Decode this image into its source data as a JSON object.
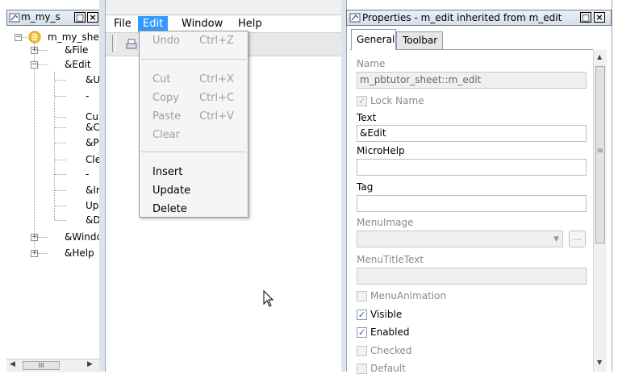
{
  "tree_panel": {
    "title": "m_my_s",
    "root_label": "m_my_shee",
    "items": [
      {
        "label": "&File",
        "depth": 1,
        "expander": "+"
      },
      {
        "label": "&Edit",
        "depth": 1,
        "expander": "-"
      },
      {
        "label": "&U",
        "depth": 2
      },
      {
        "label": "-",
        "depth": 2
      },
      {
        "label": "Cu",
        "depth": 2
      },
      {
        "label": "&C",
        "depth": 2
      },
      {
        "label": "&P",
        "depth": 2
      },
      {
        "label": "Cle",
        "depth": 2
      },
      {
        "label": "-",
        "depth": 2
      },
      {
        "label": "&Ir",
        "depth": 2
      },
      {
        "label": "Up",
        "depth": 2
      },
      {
        "label": "&D",
        "depth": 2
      },
      {
        "label": "&Windc",
        "depth": 1,
        "expander": "+"
      },
      {
        "label": "&Help",
        "depth": 1,
        "expander": "+"
      }
    ],
    "scroll_grip": "III"
  },
  "menubar": {
    "items": [
      "File",
      "Edit",
      "Window",
      "Help"
    ],
    "active": "Edit"
  },
  "edit_menu": {
    "items": [
      {
        "label": "Undo",
        "shortcut": "Ctrl+Z",
        "enabled": false
      },
      {
        "label": "Cut",
        "shortcut": "Ctrl+X",
        "enabled": false
      },
      {
        "label": "Copy",
        "shortcut": "Ctrl+C",
        "enabled": false
      },
      {
        "label": "Paste",
        "shortcut": "Ctrl+V",
        "enabled": false
      },
      {
        "label": "Clear",
        "shortcut": "",
        "enabled": false
      },
      {
        "label": "Insert",
        "shortcut": "",
        "enabled": true
      },
      {
        "label": "Update",
        "shortcut": "",
        "enabled": true
      },
      {
        "label": "Delete",
        "shortcut": "",
        "enabled": true
      }
    ]
  },
  "properties": {
    "title": "Properties - m_edit inherited from m_edit",
    "tabs": [
      "General",
      "Toolbar"
    ],
    "active_tab": "General",
    "name_label": "Name",
    "name_value": "m_pbtutor_sheet::m_edit",
    "lock_name_label": "Lock Name",
    "lock_name_checked": true,
    "text_label": "Text",
    "text_value": "&Edit",
    "microhelp_label": "MicroHelp",
    "microhelp_value": "",
    "tag_label": "Tag",
    "tag_value": "",
    "menuimage_label": "MenuImage",
    "menuimage_value": "",
    "browse_label": "...",
    "menutitletext_label": "MenuTitleText",
    "menutitletext_value": "",
    "checkboxes": [
      {
        "label": "MenuAnimation",
        "checked": false,
        "enabled": false
      },
      {
        "label": "Visible",
        "checked": true,
        "enabled": true
      },
      {
        "label": "Enabled",
        "checked": true,
        "enabled": true
      },
      {
        "label": "Checked",
        "checked": false,
        "enabled": false
      },
      {
        "label": "Default",
        "checked": false,
        "enabled": false
      }
    ]
  },
  "colors": {
    "menu_highlight": "#3399ff",
    "title_gradient_top": "#eaf0f8",
    "title_gradient_bottom": "#d5dee9"
  }
}
